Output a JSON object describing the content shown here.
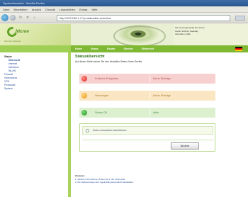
{
  "browser": {
    "window_title": "Systemübersicht - Mozilla Firefox",
    "menu": [
      "Datei",
      "Bearbeiten",
      "Ansicht",
      "Chronik",
      "Lesezeichen",
      "Extras",
      "Hilfe"
    ],
    "address": "http://192.168.1.1/?p=status&s=overview"
  },
  "header": {
    "logo_text": "Nicroe",
    "logo_sub": "Security Gateway",
    "info_lines": [
      "Sie sind angemeldet als: admin",
      "Gerät: Security Gateway",
      "Abmelden | Hilfe"
    ]
  },
  "navbar": {
    "items": [
      "Home",
      "Status",
      "Router",
      "Dienste"
    ],
    "extra": "Sicherheit"
  },
  "sidebar": {
    "heading": "Status",
    "items": [
      "Übersicht",
      "Internet",
      "Netzwerk",
      "WLAN",
      "Firewall",
      "Virenschutz",
      "VPN",
      "Protokolle",
      "System"
    ]
  },
  "main": {
    "title": "Statusübersicht",
    "intro": "Auf dieser Seite sehen Sie den aktuellen Status Ihres Geräts."
  },
  "status": [
    {
      "label": "Kritische Ereignisse",
      "value": "Keine Einträge"
    },
    {
      "label": "Warnungen",
      "value": "Keine Einträge"
    },
    {
      "label": "Status OK",
      "value": "Aktiv"
    }
  ],
  "panel": {
    "row_text": "Status automatisch aktualisieren",
    "button_label": "Ändern"
  },
  "hints": {
    "title": "Hinweise:",
    "lines": [
      "1. Weitere Informationen finden Sie in der Onlinehilfe.",
      "2. Die Statusanzeige wird regelmäßig automatisch aktualisiert."
    ]
  }
}
